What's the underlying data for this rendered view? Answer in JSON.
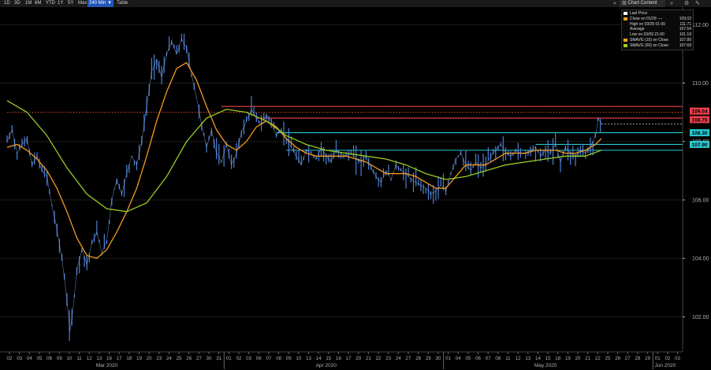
{
  "toolbar": {
    "periods": [
      "1D",
      "3D",
      "1M",
      "6M",
      "YTD",
      "1Y",
      "5Y",
      "Max",
      "240 Min ▼"
    ],
    "active_period": "240 Min ▼",
    "table_label": "Table",
    "chart_content_label": "Chart Content",
    "prev_icon": "double-left-chevron-icon",
    "next_icon": "double-right-chevron-icon",
    "settings_icon": "gear-icon",
    "edit_icon": "pencil-icon"
  },
  "legend": {
    "rows": [
      {
        "label": "Last Price",
        "value": "",
        "color": "#ffffff"
      },
      {
        "label": "Close on 01/29 ----",
        "value": "109.02",
        "color": "#e8a020"
      },
      {
        "label": "High on 03/25 01:00",
        "value": "111.71",
        "color": ""
      },
      {
        "label": "Average",
        "value": "107.54",
        "color": ""
      },
      {
        "label": "Low on 03/09 21:00",
        "value": "101.18",
        "color": ""
      },
      {
        "label": "SMAVG (15)  on Close",
        "value": "107.89",
        "color": "#f0a020"
      },
      {
        "label": "SMAVG (60)  on Close",
        "value": "107.69",
        "color": "#a5d21a"
      }
    ]
  },
  "colors": {
    "price": "#4a80d8",
    "sma15": "#f39a1e",
    "sma60": "#99cc22",
    "dotted": "#e0501e",
    "red_level": "#e8404a",
    "cyan_level": "#28c8d0",
    "grid": "#1c1c1c",
    "axis": "#b0b0b0"
  },
  "chart_data": {
    "type": "line",
    "ylim": [
      100.8,
      112.6
    ],
    "yticks": [
      "112.00",
      "110.00",
      "108.00",
      "106.00",
      "104.00",
      "102.00"
    ],
    "ytick_values": [
      112,
      110,
      108,
      106,
      104,
      102
    ],
    "x_day_labels": [
      "02",
      "03",
      "04",
      "05",
      "06",
      "09",
      "10",
      "11",
      "12",
      "13",
      "16",
      "17",
      "18",
      "19",
      "20",
      "23",
      "24",
      "25",
      "26",
      "27",
      "30",
      "31",
      "01",
      "02",
      "03",
      "06",
      "07",
      "08",
      "09",
      "10",
      "13",
      "14",
      "15",
      "16",
      "17",
      "20",
      "21",
      "22",
      "23",
      "24",
      "27",
      "28",
      "29",
      "30",
      "01",
      "04",
      "05",
      "06",
      "07",
      "08",
      "11",
      "12",
      "13",
      "14",
      "15",
      "18",
      "19",
      "20",
      "21",
      "22",
      "25",
      "26",
      "27",
      "28",
      "29",
      "01",
      "02",
      "03"
    ],
    "x_month_labels": [
      {
        "label": "Mar 2020",
        "day_index": 10
      },
      {
        "label": "Apr 2020",
        "day_index": 32
      },
      {
        "label": "May 2020",
        "day_index": 54
      },
      {
        "label": "Jun 2020",
        "day_index": 66
      }
    ],
    "month_separators_at_day_index": [
      22,
      44,
      65
    ],
    "series": [
      {
        "key": "price",
        "points": [
          [
            0,
            108.0
          ],
          [
            0.5,
            108.4
          ],
          [
            1,
            107.6
          ],
          [
            1.5,
            107.9
          ],
          [
            2,
            108.1
          ],
          [
            2.5,
            107.2
          ],
          [
            3,
            107.5
          ],
          [
            3.5,
            107.0
          ],
          [
            4,
            106.8
          ],
          [
            4.5,
            105.8
          ],
          [
            5,
            105.0
          ],
          [
            5.5,
            104.0
          ],
          [
            6,
            102.6
          ],
          [
            6.3,
            101.5
          ],
          [
            6.6,
            102.2
          ],
          [
            7,
            103.6
          ],
          [
            7.5,
            104.3
          ],
          [
            8,
            103.8
          ],
          [
            8.5,
            104.5
          ],
          [
            9,
            104.9
          ],
          [
            9.5,
            104.2
          ],
          [
            10,
            104.6
          ],
          [
            10.5,
            106.0
          ],
          [
            11,
            106.7
          ],
          [
            11.5,
            106.2
          ],
          [
            12,
            106.9
          ],
          [
            12.5,
            107.5
          ],
          [
            13,
            107.2
          ],
          [
            13.5,
            108.0
          ],
          [
            14,
            109.2
          ],
          [
            14.5,
            110.4
          ],
          [
            15,
            110.8
          ],
          [
            15.5,
            110.2
          ],
          [
            16,
            111.0
          ],
          [
            16.5,
            111.4
          ],
          [
            17,
            111.0
          ],
          [
            17.5,
            111.5
          ],
          [
            18,
            111.2
          ],
          [
            18.5,
            110.3
          ],
          [
            19,
            109.5
          ],
          [
            19.5,
            108.6
          ],
          [
            20,
            107.8
          ],
          [
            20.5,
            108.4
          ],
          [
            21,
            107.6
          ],
          [
            21.5,
            107.3
          ],
          [
            22,
            107.9
          ],
          [
            22.5,
            107.2
          ],
          [
            23,
            107.6
          ],
          [
            23.5,
            108.3
          ],
          [
            24,
            108.7
          ],
          [
            24.5,
            109.1
          ],
          [
            25,
            108.8
          ],
          [
            25.5,
            108.6
          ],
          [
            26,
            108.9
          ],
          [
            26.5,
            108.7
          ],
          [
            27,
            108.2
          ],
          [
            27.5,
            108.4
          ],
          [
            28,
            108.1
          ],
          [
            28.5,
            107.8
          ],
          [
            29,
            107.5
          ],
          [
            29.5,
            107.2
          ],
          [
            30,
            107.7
          ],
          [
            30.5,
            107.6
          ],
          [
            31,
            107.4
          ],
          [
            31.5,
            107.8
          ],
          [
            32,
            107.5
          ],
          [
            32.5,
            107.3
          ],
          [
            33,
            107.7
          ],
          [
            33.5,
            107.6
          ],
          [
            34,
            107.5
          ],
          [
            34.5,
            107.6
          ],
          [
            35,
            107.4
          ],
          [
            35.5,
            107.3
          ],
          [
            36,
            107.5
          ],
          [
            36.5,
            107.1
          ],
          [
            37,
            106.8
          ],
          [
            37.5,
            106.6
          ],
          [
            38,
            107.0
          ],
          [
            38.5,
            106.7
          ],
          [
            39,
            107.2
          ],
          [
            39.5,
            107.0
          ],
          [
            40,
            106.9
          ],
          [
            40.5,
            106.7
          ],
          [
            41,
            106.6
          ],
          [
            41.5,
            106.5
          ],
          [
            42,
            106.4
          ],
          [
            42.5,
            106.2
          ],
          [
            43,
            106.3
          ],
          [
            43.5,
            106.5
          ],
          [
            44,
            106.3
          ],
          [
            44.5,
            106.9
          ],
          [
            45,
            107.4
          ],
          [
            45.5,
            107.6
          ],
          [
            46,
            107.2
          ],
          [
            46.5,
            107.0
          ],
          [
            47,
            107.3
          ],
          [
            47.5,
            107.1
          ],
          [
            48,
            107.2
          ],
          [
            48.5,
            107.5
          ],
          [
            49,
            107.7
          ],
          [
            49.5,
            107.9
          ],
          [
            50,
            107.6
          ],
          [
            50.5,
            107.5
          ],
          [
            51,
            107.7
          ],
          [
            51.5,
            107.6
          ],
          [
            52,
            107.6
          ],
          [
            52.5,
            107.7
          ],
          [
            53,
            107.8
          ],
          [
            53.5,
            107.5
          ],
          [
            54,
            107.7
          ],
          [
            54.5,
            107.6
          ],
          [
            55,
            107.9
          ],
          [
            55.5,
            107.3
          ],
          [
            56,
            107.8
          ],
          [
            56.5,
            107.6
          ],
          [
            57,
            107.5
          ],
          [
            57.5,
            107.7
          ],
          [
            58,
            107.6
          ],
          [
            58.5,
            107.8
          ],
          [
            59,
            108.2
          ],
          [
            59.3,
            108.8
          ],
          [
            59.6,
            108.6
          ]
        ]
      },
      {
        "key": "sma15",
        "points": [
          [
            0,
            107.8
          ],
          [
            1,
            107.9
          ],
          [
            2,
            107.7
          ],
          [
            3,
            107.4
          ],
          [
            4,
            107.0
          ],
          [
            5,
            106.4
          ],
          [
            6,
            105.6
          ],
          [
            7,
            104.7
          ],
          [
            8,
            104.1
          ],
          [
            9,
            104.0
          ],
          [
            10,
            104.3
          ],
          [
            11,
            104.9
          ],
          [
            12,
            105.6
          ],
          [
            13,
            106.4
          ],
          [
            14,
            107.5
          ],
          [
            15,
            108.7
          ],
          [
            16,
            109.7
          ],
          [
            17,
            110.5
          ],
          [
            18,
            110.7
          ],
          [
            19,
            110.1
          ],
          [
            20,
            109.2
          ],
          [
            21,
            108.4
          ],
          [
            22,
            107.9
          ],
          [
            23,
            107.7
          ],
          [
            24,
            108.0
          ],
          [
            25,
            108.5
          ],
          [
            26,
            108.7
          ],
          [
            27,
            108.5
          ],
          [
            28,
            108.1
          ],
          [
            29,
            107.8
          ],
          [
            30,
            107.6
          ],
          [
            31,
            107.5
          ],
          [
            32,
            107.5
          ],
          [
            33,
            107.5
          ],
          [
            34,
            107.5
          ],
          [
            35,
            107.4
          ],
          [
            36,
            107.3
          ],
          [
            37,
            107.1
          ],
          [
            38,
            106.9
          ],
          [
            39,
            106.9
          ],
          [
            40,
            106.9
          ],
          [
            41,
            106.8
          ],
          [
            42,
            106.6
          ],
          [
            43,
            106.4
          ],
          [
            44,
            106.4
          ],
          [
            45,
            106.8
          ],
          [
            46,
            107.2
          ],
          [
            47,
            107.2
          ],
          [
            48,
            107.2
          ],
          [
            49,
            107.4
          ],
          [
            50,
            107.6
          ],
          [
            51,
            107.6
          ],
          [
            52,
            107.6
          ],
          [
            53,
            107.7
          ],
          [
            54,
            107.7
          ],
          [
            55,
            107.7
          ],
          [
            56,
            107.6
          ],
          [
            57,
            107.6
          ],
          [
            58,
            107.7
          ],
          [
            59,
            107.9
          ],
          [
            59.6,
            108.1
          ]
        ]
      },
      {
        "key": "sma60",
        "points": [
          [
            0,
            109.4
          ],
          [
            2,
            109.0
          ],
          [
            4,
            108.2
          ],
          [
            6,
            107.1
          ],
          [
            8,
            106.2
          ],
          [
            10,
            105.7
          ],
          [
            12,
            105.6
          ],
          [
            14,
            105.9
          ],
          [
            16,
            106.8
          ],
          [
            18,
            108.0
          ],
          [
            20,
            108.8
          ],
          [
            22,
            109.1
          ],
          [
            24,
            109.0
          ],
          [
            26,
            108.7
          ],
          [
            28,
            108.2
          ],
          [
            30,
            107.9
          ],
          [
            32,
            107.7
          ],
          [
            34,
            107.6
          ],
          [
            36,
            107.5
          ],
          [
            38,
            107.4
          ],
          [
            40,
            107.2
          ],
          [
            42,
            106.9
          ],
          [
            44,
            106.7
          ],
          [
            46,
            106.8
          ],
          [
            48,
            107.0
          ],
          [
            50,
            107.2
          ],
          [
            52,
            107.3
          ],
          [
            54,
            107.4
          ],
          [
            56,
            107.5
          ],
          [
            58,
            107.5
          ],
          [
            59.6,
            107.7
          ]
        ]
      }
    ],
    "levels": [
      {
        "name": "dotted-close-line",
        "y": 109.0,
        "x_from_day": 0,
        "style": "dotted"
      },
      {
        "name": "red-resistance-1",
        "y": 109.2,
        "x_from_day": 21.5,
        "style": "red"
      },
      {
        "name": "red-resistance-2",
        "y": 108.8,
        "x_from_day": 25.0,
        "style": "red"
      },
      {
        "name": "cyan-level-1",
        "y": 108.3,
        "x_from_day": 27.0,
        "style": "cyan"
      },
      {
        "name": "cyan-level-2",
        "y": 107.9,
        "x_from_day": 53.0,
        "style": "cyan"
      },
      {
        "name": "cyan-level-3",
        "y": 107.7,
        "x_from_day": 28.0,
        "style": "cyan"
      }
    ],
    "price_tags": [
      {
        "label": "109.04",
        "y": 109.04,
        "color": "#e8404a"
      },
      {
        "label": "108.75",
        "y": 108.75,
        "color": "#e8404a"
      },
      {
        "label": "108.30",
        "y": 108.3,
        "color": "#28c8d0"
      },
      {
        "label": "107.90",
        "y": 107.9,
        "color": "#28c8d0"
      }
    ]
  }
}
